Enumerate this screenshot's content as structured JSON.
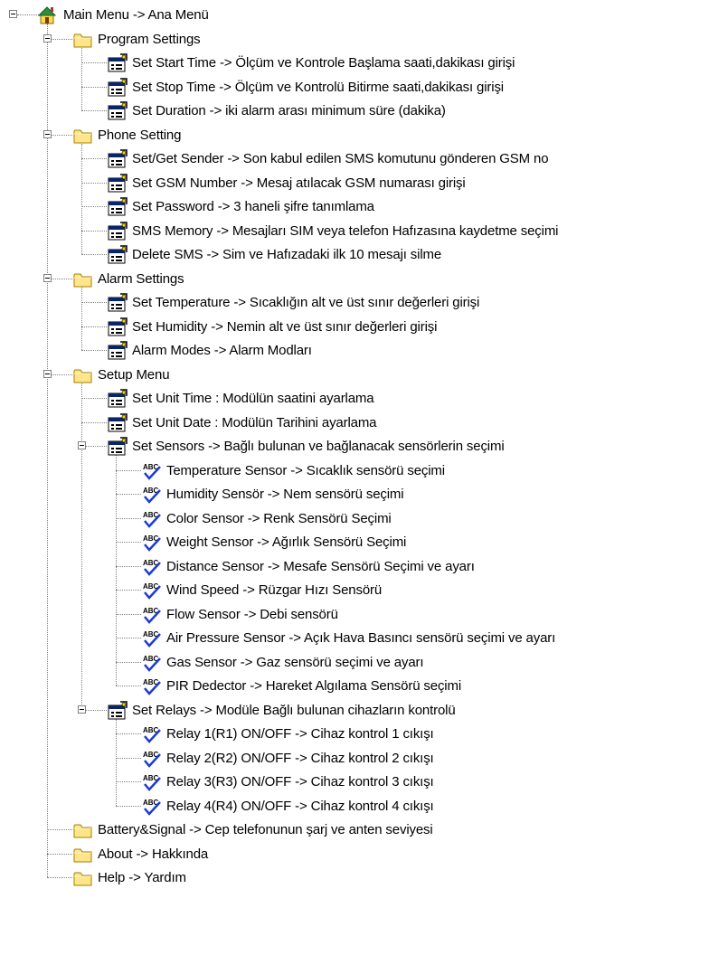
{
  "tree": {
    "main": "Main Menu -> Ana Menü",
    "program_settings": {
      "label": "Program Settings",
      "items": [
        "Set Start Time -> Ölçüm ve Kontrole Başlama saati,dakikası girişi",
        "Set Stop Time -> Ölçüm ve Kontrolü Bitirme saati,dakikası girişi",
        "Set Duration -> iki alarm arası minimum süre (dakika)"
      ]
    },
    "phone_setting": {
      "label": "Phone Setting",
      "items": [
        "Set/Get Sender -> Son kabul edilen SMS komutunu gönderen GSM no",
        "Set GSM Number -> Mesaj atılacak GSM numarası girişi",
        "Set Password -> 3 haneli şifre tanımlama",
        "SMS Memory -> Mesajları SIM veya telefon Hafızasına kaydetme seçimi",
        "Delete SMS -> Sim ve Hafızadaki ilk 10 mesajı silme"
      ]
    },
    "alarm_settings": {
      "label": "Alarm Settings",
      "items": [
        "Set Temperature -> Sıcaklığın alt ve üst sınır değerleri girişi",
        "Set Humidity -> Nemin alt ve üst sınır değerleri girişi",
        "Alarm Modes -> Alarm Modları"
      ]
    },
    "setup_menu": {
      "label": "Setup Menu",
      "unit_time": "Set Unit Time : Modülün saatini ayarlama",
      "unit_date": "Set Unit Date : Modülün Tarihini ayarlama",
      "sensors": {
        "label": "Set Sensors -> Bağlı bulunan ve bağlanacak sensörlerin seçimi",
        "items": [
          "Temperature Sensor -> Sıcaklık sensörü seçimi",
          "Humidity Sensör -> Nem sensörü seçimi",
          "Color Sensor -> Renk Sensörü Seçimi",
          "Weight Sensor -> Ağırlık Sensörü Seçimi",
          "Distance Sensor -> Mesafe Sensörü Seçimi ve ayarı",
          "Wind Speed -> Rüzgar Hızı Sensörü",
          "Flow Sensor -> Debi sensörü",
          "Air Pressure Sensor -> Açık Hava Basıncı sensörü seçimi ve ayarı",
          "Gas Sensor -> Gaz sensörü seçimi ve ayarı",
          "PIR Dedector -> Hareket Algılama Sensörü seçimi"
        ]
      },
      "relays": {
        "label": "Set Relays -> Modüle Bağlı bulunan cihazların kontrolü",
        "items": [
          "Relay 1(R1) ON/OFF -> Cihaz kontrol 1 cıkışı",
          "Relay 2(R2) ON/OFF -> Cihaz kontrol 2 cıkışı",
          "Relay 3(R3) ON/OFF -> Cihaz kontrol 3 cıkışı",
          "Relay 4(R4) ON/OFF -> Cihaz kontrol 4 cıkışı"
        ]
      }
    },
    "battery": "Battery&Signal -> Cep telefonunun şarj ve anten seviyesi",
    "about": "About -> Hakkında",
    "help": "Help -> Yardım"
  },
  "icons": {
    "root": "home-icon",
    "folder": "folder-icon",
    "property": "properties-icon",
    "spell": "spellcheck-icon"
  }
}
